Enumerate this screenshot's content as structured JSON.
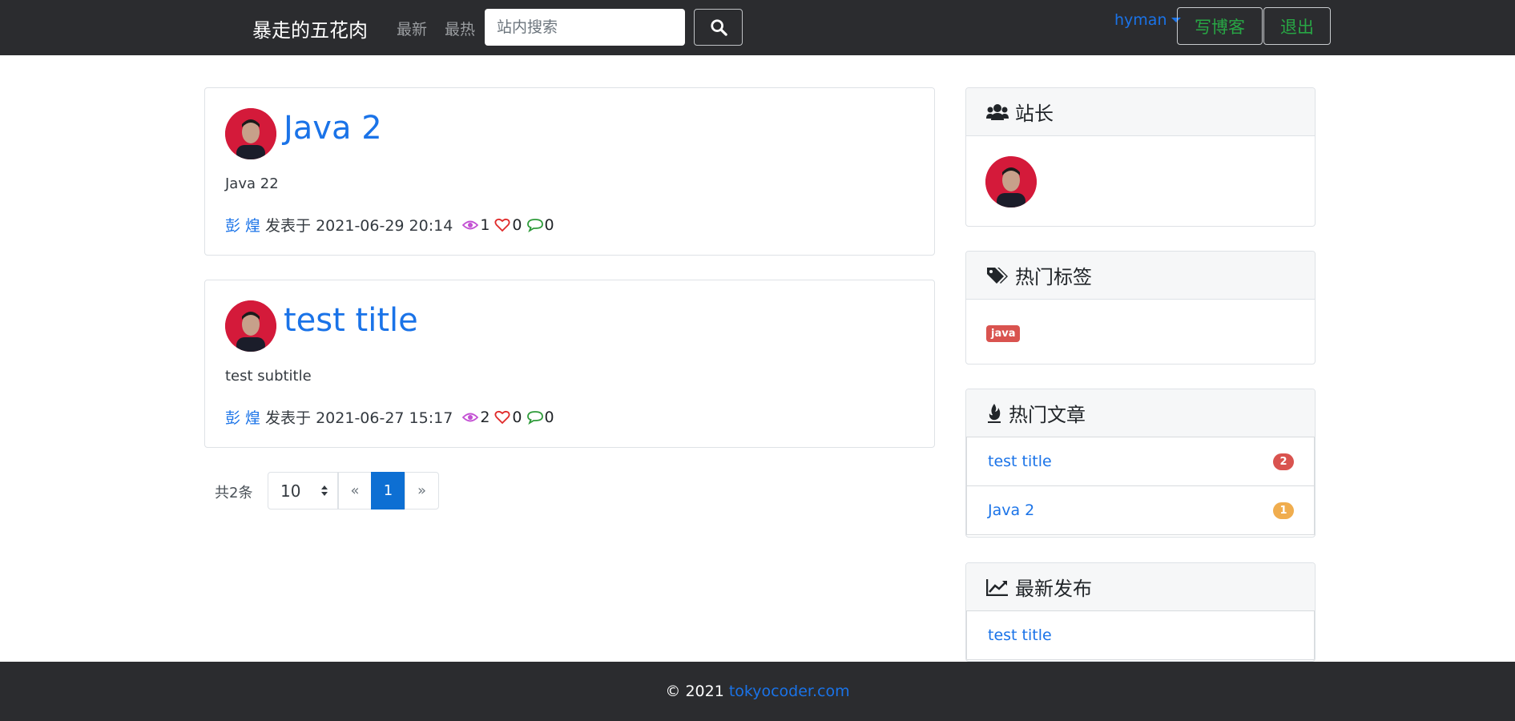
{
  "navbar": {
    "brand": "暴走的五花肉",
    "links": [
      "最新",
      "最热"
    ],
    "search_placeholder": "站内搜索",
    "user": "hyman",
    "write_button": "写博客",
    "logout_button": "退出"
  },
  "posts": [
    {
      "title": "Java 2",
      "subtitle": "Java 22",
      "author": "彭 煌",
      "published_label": "发表于 2021-06-29 20:14",
      "views": "1",
      "likes": "0",
      "comments": "0"
    },
    {
      "title": "test title",
      "subtitle": "test subtitle",
      "author": "彭 煌",
      "published_label": "发表于 2021-06-27 15:17",
      "views": "2",
      "likes": "0",
      "comments": "0"
    }
  ],
  "pagination": {
    "total": "共2条",
    "page_size": "10",
    "prev": "«",
    "current": "1",
    "next": "»"
  },
  "sidebar": {
    "owner_title": "站长",
    "tags_title": "热门标签",
    "tags": [
      "java"
    ],
    "hot_title": "热门文章",
    "hot_articles": [
      {
        "title": "test title",
        "count": "2",
        "badge_color": "#d9534f"
      },
      {
        "title": "Java 2",
        "count": "1",
        "badge_color": "#f0ad4e"
      }
    ],
    "latest_title": "最新发布",
    "latest_articles": [
      "test title"
    ]
  },
  "footer": {
    "copyright": "© 2021",
    "link": "tokyocoder.com"
  },
  "colors": {
    "navbar_bg": "#2b2c2f",
    "link_blue": "#1a73e8",
    "success_green": "#28a745",
    "active_page": "#0d6fd3"
  }
}
